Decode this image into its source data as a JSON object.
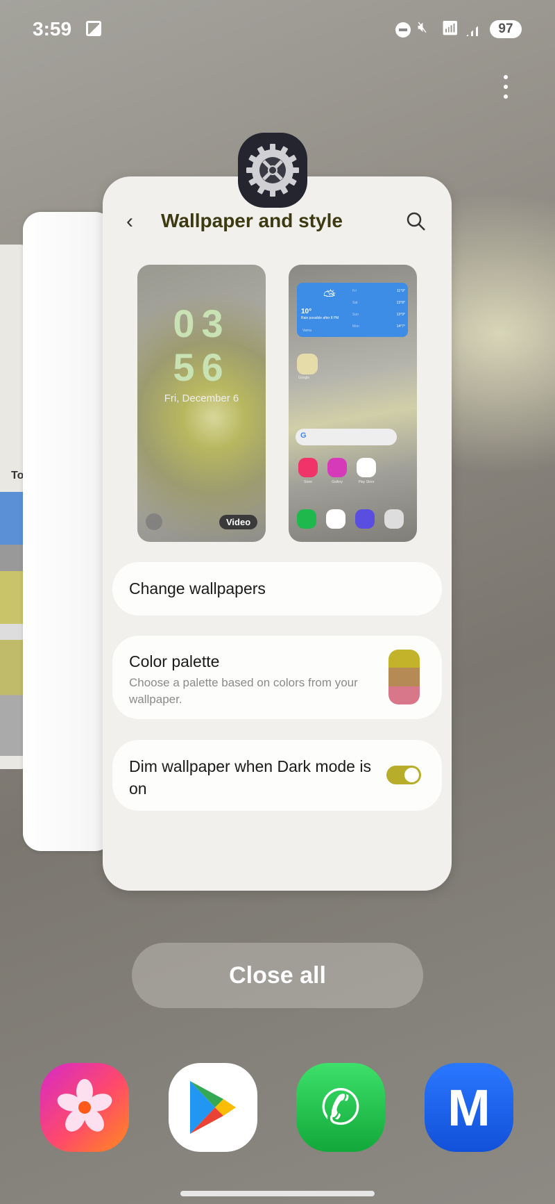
{
  "status_bar": {
    "time": "3:59",
    "battery": "97",
    "icons": [
      "image-icon",
      "dnd-icon",
      "mute-icon",
      "wifi-6-icon",
      "signal-icon"
    ]
  },
  "recents": {
    "left_card_fragment": "To",
    "app_icon": "settings-gear-icon",
    "card": {
      "title": "Wallpaper and style",
      "lock_preview": {
        "clock_line1": "03",
        "clock_line2": "56",
        "date": "Fri, December 6",
        "badge": "Video"
      },
      "home_preview": {
        "weather": {
          "temp": "10°",
          "desc": "Rain possible after 8 PM",
          "location": "Varna",
          "forecast": [
            {
              "day": "Fri",
              "temp": "11°9°"
            },
            {
              "day": "Sat",
              "temp": "13°8°"
            },
            {
              "day": "Sun",
              "temp": "13°9°"
            },
            {
              "day": "Mon",
              "temp": "14°7°"
            }
          ]
        },
        "folder_label": "Google",
        "apps": [
          "Store",
          "Gallery",
          "Play Store"
        ]
      },
      "rows": [
        {
          "title": "Change wallpapers"
        },
        {
          "title": "Color palette",
          "subtitle": "Choose a palette based on colors from your wallpaper.",
          "palette": [
            "#c2b32a",
            "#b58a55",
            "#d9778a"
          ]
        },
        {
          "title": "Dim wallpaper when Dark mode is on",
          "toggle_on": true,
          "toggle_color": "#b8ad2a"
        }
      ]
    },
    "close_all": "Close all"
  },
  "dock": [
    {
      "name": "Gallery"
    },
    {
      "name": "Play Store"
    },
    {
      "name": "Phone"
    },
    {
      "name": "Samsung Members"
    }
  ]
}
